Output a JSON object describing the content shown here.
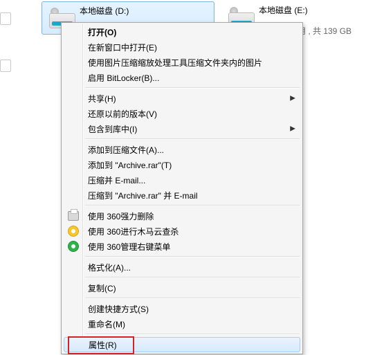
{
  "drives": {
    "d": {
      "label": "本地磁盘 (D:)"
    },
    "e": {
      "label": "本地磁盘 (E:)",
      "usage_tail": "用 , 共 139 GB"
    }
  },
  "menu": {
    "open": "打开(O)",
    "open_new_win": "在新窗口中打开(E)",
    "img_compress": "使用图片压缩缩放处理工具压缩文件夹内的图片",
    "bitlocker": "启用 BitLocker(B)...",
    "share": "共享(H)",
    "restore_prev": "还原以前的版本(V)",
    "include_lib": "包含到库中(I)",
    "add_archive_a": "添加到压缩文件(A)...",
    "add_archive_t": "添加到 \"Archive.rar\"(T)",
    "compress_email": "压缩并 E-mail...",
    "compress_email2": "压缩到 \"Archive.rar\" 并 E-mail",
    "del_360": "使用 360强力删除",
    "scan_360": "使用 360进行木马云查杀",
    "menu_360": "使用 360管理右键菜单",
    "format": "格式化(A)...",
    "copy": "复制(C)",
    "shortcut": "创建快捷方式(S)",
    "rename": "重命名(M)",
    "properties": "属性(R)"
  }
}
